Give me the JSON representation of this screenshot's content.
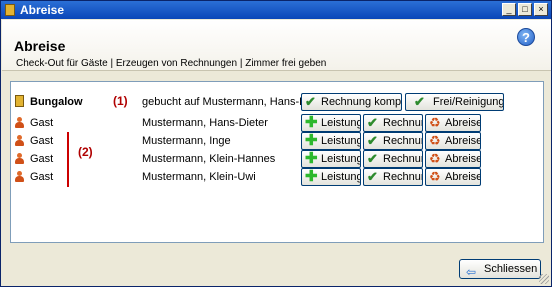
{
  "window": {
    "title": "Abreise"
  },
  "header": {
    "title": "Abreise",
    "subtitle": "Check-Out für Gäste | Erzeugen von Rechnungen | Zimmer frei geben",
    "help_icon": "?"
  },
  "annotations": {
    "one": "(1)",
    "two": "(2)"
  },
  "rows": [
    {
      "type": "Bungalow",
      "name": "gebucht auf Mustermann, Hans-Dieter",
      "btn1": "Rechnung komplett",
      "btn2": "Frei/Reinigung"
    },
    {
      "type": "Gast",
      "name": "Mustermann, Hans-Dieter",
      "btn1": "Leistung",
      "btn2": "Rechnung",
      "btn3": "Abreise"
    },
    {
      "type": "Gast",
      "name": "Mustermann, Inge",
      "btn1": "Leistung",
      "btn2": "Rechnung",
      "btn3": "Abreise"
    },
    {
      "type": "Gast",
      "name": "Mustermann, Klein-Hannes",
      "btn1": "Leistung",
      "btn2": "Rechnung",
      "btn3": "Abreise"
    },
    {
      "type": "Gast",
      "name": "Mustermann, Klein-Uwi",
      "btn1": "Leistung",
      "btn2": "Rechnung",
      "btn3": "Abreise"
    }
  ],
  "footer": {
    "close_label": "Schliessen"
  },
  "colors": {
    "title_bar": "#0a46b8",
    "annotation": "#cc0000",
    "window_bg": "#ece9d8"
  }
}
